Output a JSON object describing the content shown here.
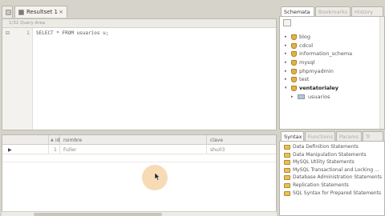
{
  "editor": {
    "tab_label": "Resultset 1",
    "tab_close": "×",
    "header_text": "1/32 Query Area",
    "gutter_fold": "⊟",
    "line_number": "1",
    "query_text": "SELECT * FROM usuarios u;"
  },
  "result_grid": {
    "columns": [
      {
        "label": "",
        "sort": ""
      },
      {
        "label": "id",
        "sort": "▲"
      },
      {
        "label": "nombre",
        "sort": ""
      },
      {
        "label": "clave",
        "sort": ""
      }
    ],
    "row": {
      "pointer": "▶",
      "id": "1",
      "nombre": "Fuller",
      "clave": "shu03"
    }
  },
  "right_tabs_top": [
    {
      "label": "Schemata",
      "active": true
    },
    {
      "label": "Bookmarks",
      "active": false
    },
    {
      "label": "History",
      "active": false
    }
  ],
  "schemata": [
    {
      "name": "blog",
      "expander": "▸"
    },
    {
      "name": "cdcol",
      "expander": "▸"
    },
    {
      "name": "information_schema",
      "expander": "▸"
    },
    {
      "name": "mysql",
      "expander": "▸"
    },
    {
      "name": "phpmyadmin",
      "expander": "▸"
    },
    {
      "name": "test",
      "expander": "▸"
    },
    {
      "name": "ventatorialey",
      "expander": "▾",
      "bold": true
    },
    {
      "name": "usuarios",
      "expander": "▸",
      "child": true
    }
  ],
  "right_tabs_bottom": [
    {
      "label": "Syntax",
      "active": true
    },
    {
      "label": "Functions",
      "active": false
    },
    {
      "label": "Params",
      "active": false
    },
    {
      "label": "Tr",
      "active": false
    }
  ],
  "syntax_items": [
    "Data Definition Statements",
    "Data Manipulation Statements",
    "MySQL Utility Statements",
    "MySQL Transactional and Locking ...",
    "Database Administration Statements",
    "Replication Statements",
    "SQL Syntax for Prepared Statements"
  ],
  "colors": {
    "background": "#d6d3cb",
    "cursor_highlight": "#f0be78",
    "folder": "#e0b34a"
  }
}
